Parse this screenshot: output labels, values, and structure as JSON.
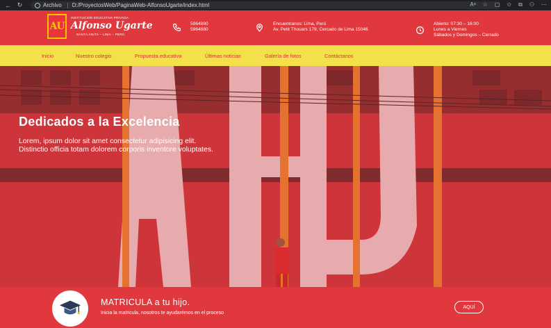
{
  "browser": {
    "scheme_label": "Archivo",
    "url": "D:/ProyectosWeb/PaginaWeb-AlfonsoUgarte/index.html"
  },
  "brand": {
    "logo_text": "AU",
    "tagline": "INSTITUCIÓN EDUCATIVA PRIVADA",
    "name": "Alfonso Ugarte",
    "place": "SANTA ANITA – LIMA – PERÚ"
  },
  "contact": {
    "phone_1": "5964880",
    "phone_2": "5964880",
    "location_1": "Encuentranos: Lima, Perú",
    "location_2": "Av. Petit Thouars 179, Cercado de Lima 15046",
    "hours_1": "Abierto: 07:30 – 16:00",
    "hours_2": "Lunes a Viernes",
    "hours_3": "Sábados y Domingos – Cerrado"
  },
  "nav": {
    "items": [
      "Inicio",
      "Nuestro colegio",
      "Propuesta educativa",
      "Últimas noticias",
      "Galería de fotos",
      "Contáctanos"
    ]
  },
  "hero": {
    "title": "Dedicados a la Excelencia",
    "text": "Lorem, ipsum dolor sit amet consectetur adipisicing elit. Distinctio officia totam dolorem corporis inventore voluptates."
  },
  "cta": {
    "title": "MATRICULA a tu hijo.",
    "subtitle": "Inicia la matricula, nosotros te ayudarémos en el proceso",
    "button_label": "AQUÍ"
  },
  "colors": {
    "primary_red": "#e0383d",
    "nav_yellow": "#f4e04a",
    "accent_orange": "#f08a1a"
  }
}
